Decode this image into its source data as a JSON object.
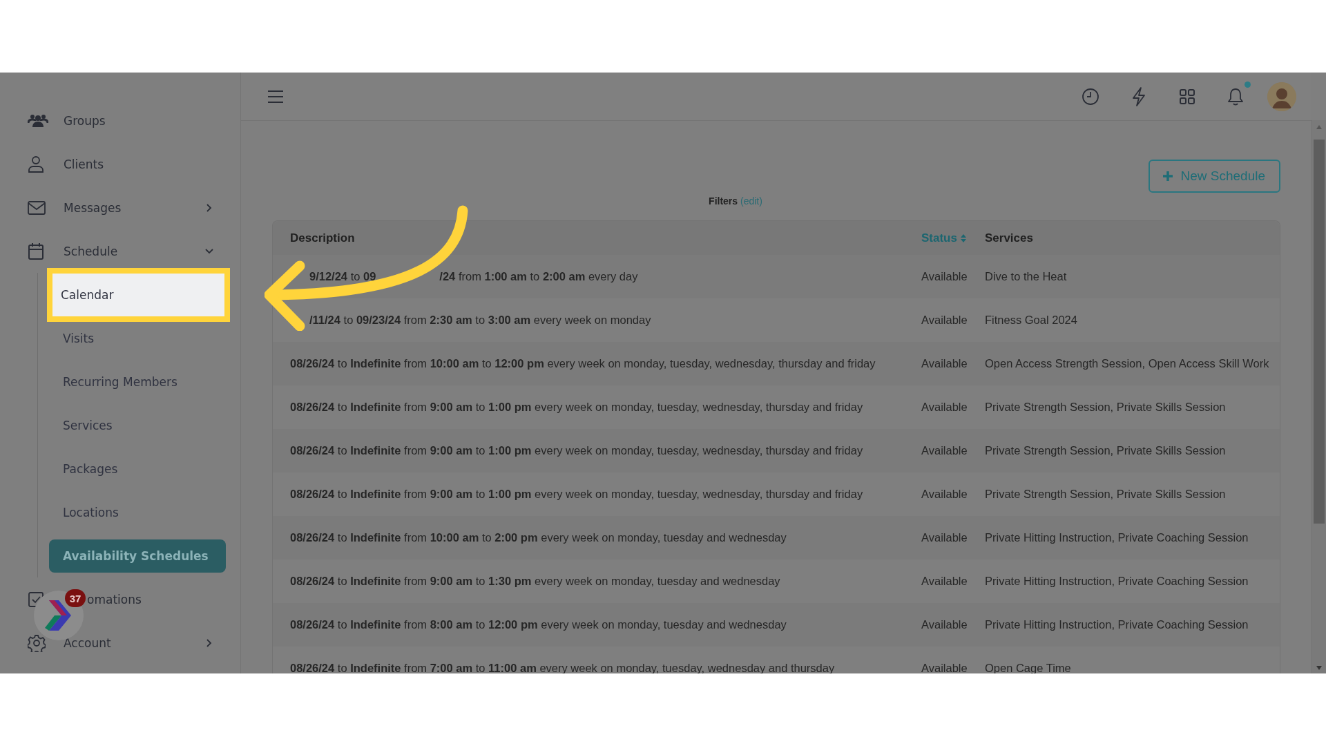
{
  "sidebar": {
    "items": [
      {
        "label": "Groups"
      },
      {
        "label": "Clients"
      },
      {
        "label": "Messages",
        "expanded": false
      },
      {
        "label": "Schedule",
        "expanded": true,
        "children": [
          {
            "label": "Calendar",
            "selected": false,
            "highlighted": true
          },
          {
            "label": "Visits",
            "selected": false,
            "highlighted": false
          },
          {
            "label": "Recurring Members",
            "selected": false,
            "highlighted": false
          },
          {
            "label": "Services",
            "selected": false,
            "highlighted": false
          },
          {
            "label": "Packages",
            "selected": false,
            "highlighted": false
          },
          {
            "label": "Locations",
            "selected": false,
            "highlighted": false
          },
          {
            "label": "Availability Schedules",
            "selected": true,
            "highlighted": false
          }
        ]
      },
      {
        "label": "omations",
        "covered_start": true
      },
      {
        "label": "Account",
        "expanded": false
      }
    ]
  },
  "widget": {
    "badge": "37"
  },
  "header": {
    "unread": true
  },
  "toolbar": {
    "button": "New Schedule",
    "filters_label": "Filters",
    "filters_link": "(edit)"
  },
  "table": {
    "columns": [
      {
        "label": "Description",
        "sortable": false
      },
      {
        "label": "Status",
        "sortable": true
      },
      {
        "label": "Services",
        "sortable": false
      }
    ],
    "rows": [
      {
        "covered_start": true,
        "description": [
          "**9/12/24** to **09**",
          "**/24** from **1:00 am** to **2:00 am** every day"
        ],
        "status": "Available",
        "services": "Dive to the Heat"
      },
      {
        "covered_start": true,
        "description": [
          "**/11/24** to **09/23/24** from **2:30 am** to **3:00 am** every week on monday"
        ],
        "status": "Available",
        "services": "Fitness Goal 2024"
      },
      {
        "description": [
          "**08/26/24** to **Indefinite** from **10:00 am** to **12:00 pm** every week on monday, tuesday, wednesday, thursday and friday"
        ],
        "status": "Available",
        "services": "Open Access Strength Session, Open Access Skill Work"
      },
      {
        "description": [
          "**08/26/24** to **Indefinite** from **9:00 am** to **1:00 pm** every week on monday, tuesday, wednesday, thursday and friday"
        ],
        "status": "Available",
        "services": "Private Strength Session, Private Skills Session"
      },
      {
        "description": [
          "**08/26/24** to **Indefinite** from **9:00 am** to **1:00 pm** every week on monday, tuesday, wednesday, thursday and friday"
        ],
        "status": "Available",
        "services": "Private Strength Session, Private Skills Session"
      },
      {
        "description": [
          "**08/26/24** to **Indefinite** from **9:00 am** to **1:00 pm** every week on monday, tuesday, wednesday, thursday and friday"
        ],
        "status": "Available",
        "services": "Private Strength Session, Private Skills Session"
      },
      {
        "description": [
          "**08/26/24** to **Indefinite** from **10:00 am** to **2:00 pm** every week on monday, tuesday and wednesday"
        ],
        "status": "Available",
        "services": "Private Hitting Instruction, Private Coaching Session"
      },
      {
        "description": [
          "**08/26/24** to **Indefinite** from **9:00 am** to **1:30 pm** every week on monday, tuesday and wednesday"
        ],
        "status": "Available",
        "services": "Private Hitting Instruction, Private Coaching Session"
      },
      {
        "description": [
          "**08/26/24** to **Indefinite** from **8:00 am** to **12:00 pm** every week on monday, tuesday and wednesday"
        ],
        "status": "Available",
        "services": "Private Hitting Instruction, Private Coaching Session"
      },
      {
        "description": [
          "**08/26/24** to **Indefinite** from **7:00 am** to **11:00 am** every week on monday, tuesday, wednesday and thursday"
        ],
        "status": "Available",
        "services": "Open Cage Time"
      }
    ]
  }
}
